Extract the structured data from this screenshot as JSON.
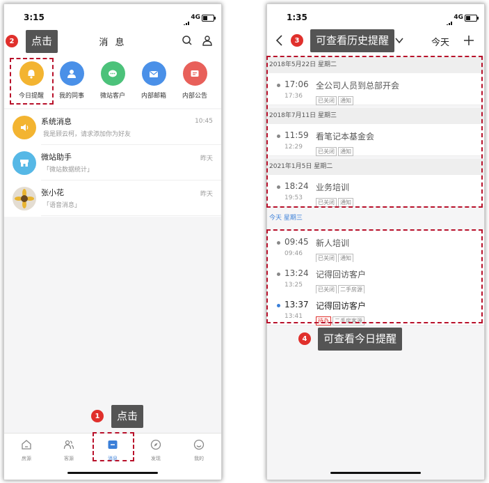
{
  "left": {
    "status_time": "3:15",
    "network": "4G",
    "title": "消 息",
    "quick_items": [
      {
        "label": "今日提醒",
        "icon": "bell-icon",
        "color": "#f3b431"
      },
      {
        "label": "我的同事",
        "icon": "person-icon",
        "color": "#4a90e8"
      },
      {
        "label": "微站客户",
        "icon": "chat-icon",
        "color": "#4cc27a"
      },
      {
        "label": "内部邮箱",
        "icon": "mail-icon",
        "color": "#4a90e8"
      },
      {
        "label": "内部公告",
        "icon": "notice-icon",
        "color": "#e8605a"
      }
    ],
    "messages": [
      {
        "name": "系统消息",
        "preview": "我是顾云柯，请求添加你为好友",
        "time": "10:45",
        "icon": "speaker-icon",
        "color": "#f3b431"
      },
      {
        "name": "微站助手",
        "preview": "「微站数据统计」",
        "time": "昨天",
        "icon": "store-icon",
        "color": "#56b8e6"
      },
      {
        "name": "张小花",
        "preview": "「语音消息」",
        "time": "昨天",
        "icon": "sunflower-avatar",
        "color": "#ddd"
      }
    ],
    "tabs": [
      {
        "label": "房源",
        "icon": "house-icon"
      },
      {
        "label": "客源",
        "icon": "people-icon"
      },
      {
        "label": "消息",
        "icon": "message-icon",
        "active": true
      },
      {
        "label": "发现",
        "icon": "compass-icon"
      },
      {
        "label": "我的",
        "icon": "smile-icon"
      }
    ]
  },
  "right": {
    "status_time": "1:35",
    "network": "4G",
    "today_label": "今天",
    "sections": [
      {
        "date": "2018年5月22日 星期二",
        "rows": [
          {
            "time": "17:06",
            "time2": "17:36",
            "title": "全公司人员到总部开会",
            "tags": [
              "已关闭",
              "通知"
            ]
          }
        ]
      },
      {
        "date": "2018年7月11日 星期三",
        "rows": [
          {
            "time": "11:59",
            "time2": "12:29",
            "title": "看笔记本基金会",
            "tags": [
              "已关闭",
              "通知"
            ]
          }
        ]
      },
      {
        "date": "2021年1月5日 星期二",
        "rows": [
          {
            "time": "18:24",
            "time2": "19:53",
            "title": "业务培训",
            "tags": [
              "已关闭",
              "通知"
            ]
          }
        ]
      }
    ],
    "today_section": "今天 星期三",
    "today_rows": [
      {
        "time": "09:45",
        "time2": "09:46",
        "title": "新人培训",
        "tags": [
          "已关闭",
          "通知"
        ]
      },
      {
        "time": "13:24",
        "time2": "13:25",
        "title": "记得回访客户",
        "tags": [
          "已关闭",
          "二手房源"
        ]
      },
      {
        "time": "13:37",
        "time2": "13:41",
        "title": "记得回访客户",
        "tags": [
          "待办",
          "二手房客源"
        ],
        "active": true
      }
    ]
  },
  "callouts": [
    {
      "num": "1",
      "text": "点击"
    },
    {
      "num": "2",
      "text": "点击"
    },
    {
      "num": "3",
      "text": "可查看历史提醒"
    },
    {
      "num": "4",
      "text": "可查看今日提醒"
    }
  ],
  "colors": {
    "accent": "#3a7fd8",
    "annotation_red": "#b8102a",
    "badge": "#e0302c",
    "tooltip": "#545454"
  }
}
